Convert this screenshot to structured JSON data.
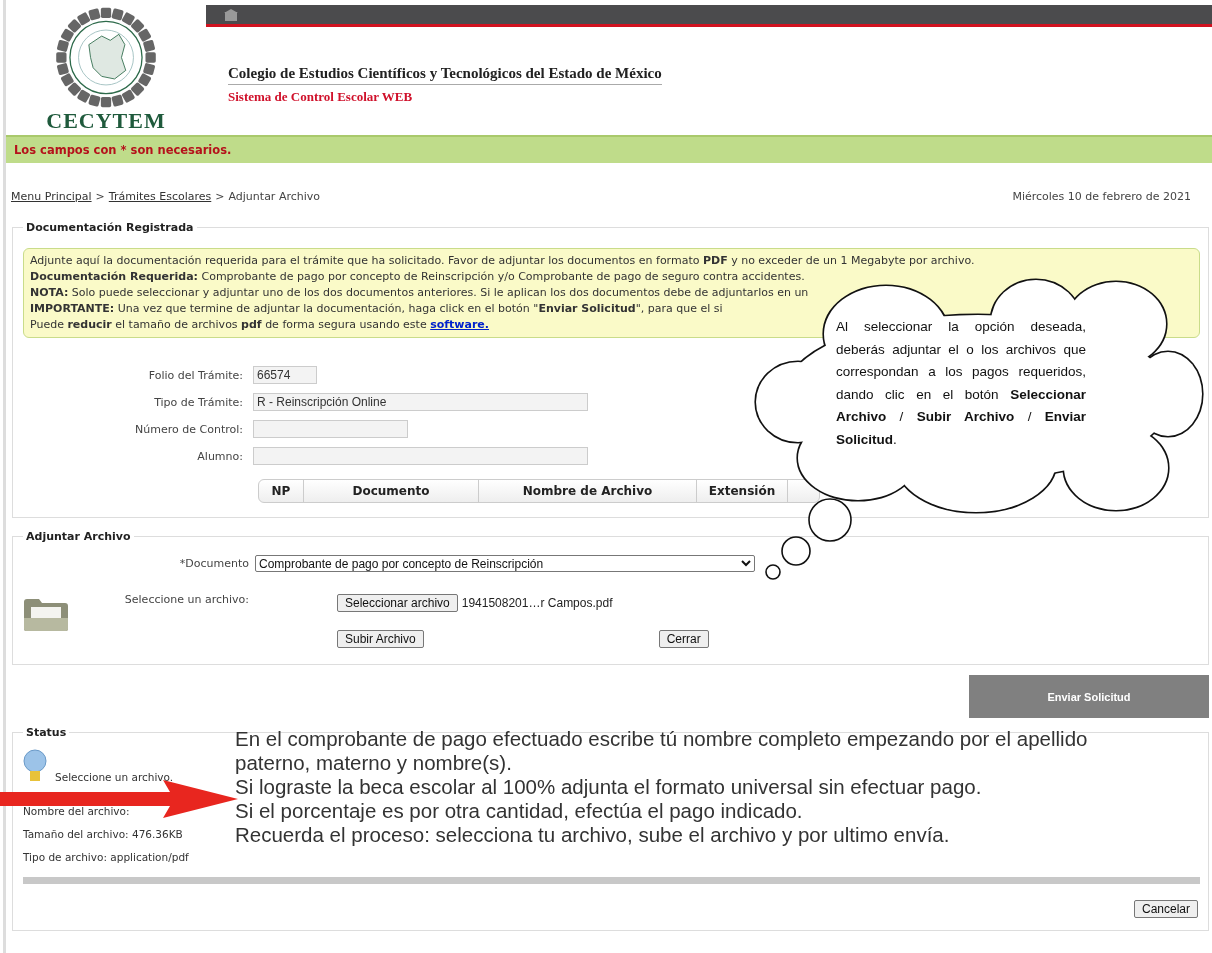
{
  "header": {
    "logo_text": "CECYTEM",
    "institution": "Colegio de Estudios Científicos y Tecnológicos del Estado de México",
    "system": "Sistema de Control Escolar WEB"
  },
  "notice_bar": "Los campos con * son necesarios.",
  "breadcrumb": {
    "links": [
      "Menu Principal",
      "Trámites Escolares"
    ],
    "separator": ">",
    "current": "Adjuntar Archivo"
  },
  "date": "Miércoles 10 de febrero de 2021",
  "documentation": {
    "legend": "Documentación Registrada",
    "instructions": [
      {
        "text": "Adjunte aquí la documentación requerida para el trámite que ha solicitado. Favor de adjuntar los documentos en formato **PDF** y no exceder de un 1 Megabyte por archivo."
      },
      {
        "text": "**Documentación Requerida:** Comprobante de pago por concepto de Reinscripción y/o Comprobante de pago de seguro contra accidentes."
      },
      {
        "text": "**NOTA:** Solo puede seleccionar y adjuntar uno de los dos documentos anteriores. Si le aplican los dos documentos debe de adjuntarlos en un"
      },
      {
        "text": "**IMPORTANTE:** Una vez que termine de adjuntar la documentación, haga click en el botón \"**Enviar Solicitud**\", para que el si"
      },
      {
        "text": "Puede **reducir** el tamaño de archivos **pdf** de forma segura usando este",
        "link": "software."
      }
    ],
    "fields": [
      {
        "label": "Folio del Trámite:",
        "value": "66574"
      },
      {
        "label": "Tipo de Trámite:",
        "value": "R - Reinscripción Online"
      },
      {
        "label": "Número de Control:"
      },
      {
        "label": "Alumno:"
      }
    ],
    "table": {
      "columns": [
        "NP",
        "Documento",
        "Nombre de Archivo",
        "Extensión"
      ]
    }
  },
  "attach": {
    "legend": "Adjuntar Archivo",
    "document_label": "*Documento",
    "document_value": "Comprobante de pago por concepto de Reinscripción",
    "file_label": "Seleccione un archivo:",
    "choose_button": "Seleccionar archivo",
    "file_name": "1941508201…r Campos.pdf",
    "upload_button": "Subir Archivo",
    "close_button": "Cerrar"
  },
  "send_button": "Enviar Solicitud",
  "status": {
    "legend": "Status",
    "message": "Seleccione un archivo.",
    "details": [
      "Nombre del archivo:",
      "Tamaño del archivo: 476.36KB",
      "Tipo de archivo: application/pdf"
    ],
    "cancel_button": "Cancelar"
  },
  "annotation": [
    "En el comprobante de pago efectuado escribe tú nombre completo empezando por el apellido paterno, materno y nombre(s).",
    "Si lograste la beca escolar al 100% adjunta el formato universal sin efectuar pago.",
    "Si el porcentaje es por otra cantidad, efectúa el pago indicado.",
    "Recuerda el proceso: selecciona tu archivo, sube el archivo y por ultimo envía."
  ],
  "callout": "Al seleccionar la opción deseada, deberás adjuntar el o los archivos que correspondan a los pagos requeridos, dando clic en el botón **Seleccionar Archivo** / **Subir Archivo** / **Enviar Solicitud**."
}
